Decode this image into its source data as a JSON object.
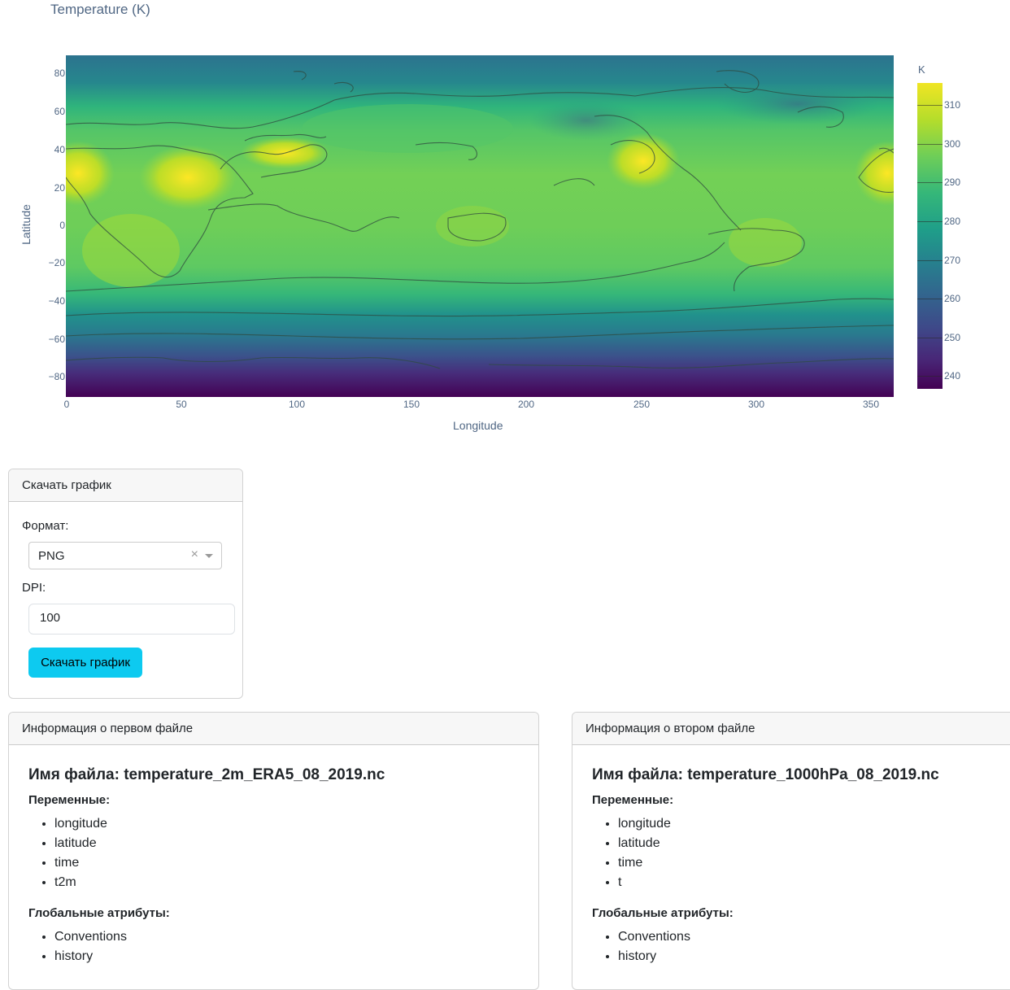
{
  "chart_data": {
    "type": "heatmap",
    "title": "Temperature (K)",
    "xlabel": "Longitude",
    "ylabel": "Latitude",
    "xlim": [
      0,
      360
    ],
    "ylim": [
      -90,
      90
    ],
    "x_ticks": [
      "0",
      "50",
      "100",
      "150",
      "200",
      "250",
      "300",
      "350"
    ],
    "y_ticks": [
      "80",
      "60",
      "40",
      "20",
      "0",
      "−20",
      "−40",
      "−60",
      "−80"
    ],
    "colorbar": {
      "title": "K",
      "colorscale": "Viridis",
      "range": [
        236,
        316
      ],
      "ticks": [
        "310",
        "300",
        "290",
        "280",
        "270",
        "260",
        "250",
        "240"
      ]
    },
    "coastlines": true
  },
  "download": {
    "header": "Скачать график",
    "format_label": "Формат:",
    "format_value": "PNG",
    "clear_symbol": "×",
    "dpi_label": "DPI:",
    "dpi_value": "100",
    "button_label": "Скачать график"
  },
  "file1": {
    "header": "Информация о первом файле",
    "filename": "Имя файла: temperature_2m_ERA5_08_2019.nc",
    "variables_label": "Переменные:",
    "variables": [
      "longitude",
      "latitude",
      "time",
      "t2m"
    ],
    "attrs_label": "Глобальные атрибуты:",
    "attrs": [
      "Conventions",
      "history"
    ]
  },
  "file2": {
    "header": "Информация о втором файле",
    "filename": "Имя файла: temperature_1000hPa_08_2019.nc",
    "variables_label": "Переменные:",
    "variables": [
      "longitude",
      "latitude",
      "time",
      "t"
    ],
    "attrs_label": "Глобальные атрибуты:",
    "attrs": [
      "Conventions",
      "history"
    ]
  }
}
